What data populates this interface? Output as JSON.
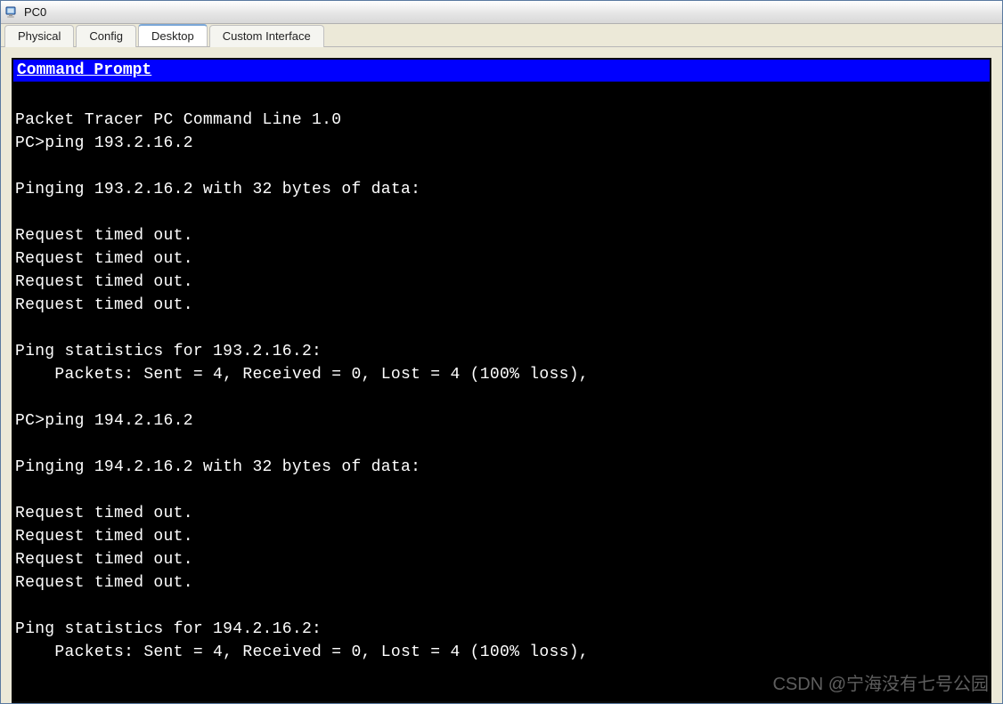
{
  "window": {
    "title": "PC0"
  },
  "tabs": [
    {
      "label": "Physical",
      "active": false
    },
    {
      "label": "Config",
      "active": false
    },
    {
      "label": "Desktop",
      "active": true
    },
    {
      "label": "Custom Interface",
      "active": false
    }
  ],
  "console": {
    "title": "Command Prompt",
    "body": "\nPacket Tracer PC Command Line 1.0\nPC>ping 193.2.16.2\n\nPinging 193.2.16.2 with 32 bytes of data:\n\nRequest timed out.\nRequest timed out.\nRequest timed out.\nRequest timed out.\n\nPing statistics for 193.2.16.2:\n    Packets: Sent = 4, Received = 0, Lost = 4 (100% loss),\n\nPC>ping 194.2.16.2\n\nPinging 194.2.16.2 with 32 bytes of data:\n\nRequest timed out.\nRequest timed out.\nRequest timed out.\nRequest timed out.\n\nPing statistics for 194.2.16.2:\n    Packets: Sent = 4, Received = 0, Lost = 4 (100% loss),"
  },
  "watermark": "CSDN @宁海没有七号公园"
}
